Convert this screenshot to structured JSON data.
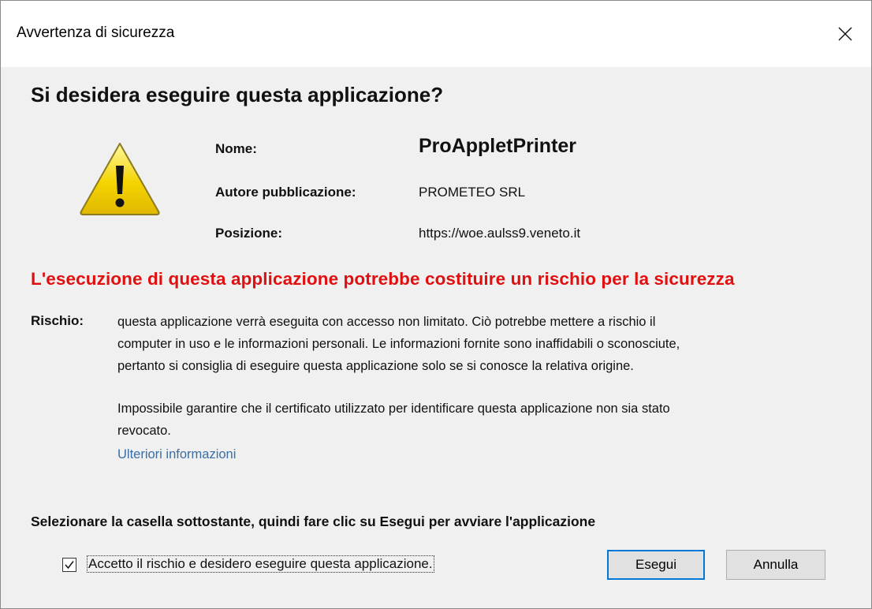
{
  "window": {
    "title": "Avvertenza di sicurezza"
  },
  "dialog": {
    "heading": "Si desidera eseguire questa applicazione?",
    "icon": "warning-icon",
    "fields": {
      "name_label": "Nome:",
      "name_value": "ProAppletPrinter",
      "publisher_label": "Autore pubblicazione:",
      "publisher_value": "PROMETEO SRL",
      "location_label": "Posizione:",
      "location_value": "https://woe.aulss9.veneto.it"
    },
    "risk_banner": "L'esecuzione di questa applicazione potrebbe costituire un rischio per la sicurezza",
    "risk_label": "Rischio:",
    "risk_lines": [
      "questa applicazione verrà eseguita con accesso non limitato. Ciò potrebbe mettere a rischio il",
      "computer in uso e le informazioni personali. Le informazioni fornite sono inaffidabili o sconosciute,",
      "pertanto si consiglia di eseguire questa applicazione solo se si conosce la relativa origine."
    ],
    "cert_lines": [
      "Impossibile garantire che il certificato utilizzato per identificare questa applicazione non sia stato",
      "revocato."
    ],
    "more_info_link": "Ulteriori informazioni",
    "instruction": "Selezionare la casella sottostante, quindi fare clic su Esegui per avviare l'applicazione",
    "accept_checkbox": {
      "label": "Accetto il rischio e desidero eseguire questa applicazione.",
      "checked": true
    },
    "buttons": {
      "run": "Esegui",
      "cancel": "Annulla"
    }
  },
  "colors": {
    "risk_text": "#e01010",
    "link": "#3a6ea5",
    "default_button_border": "#0078d7"
  }
}
